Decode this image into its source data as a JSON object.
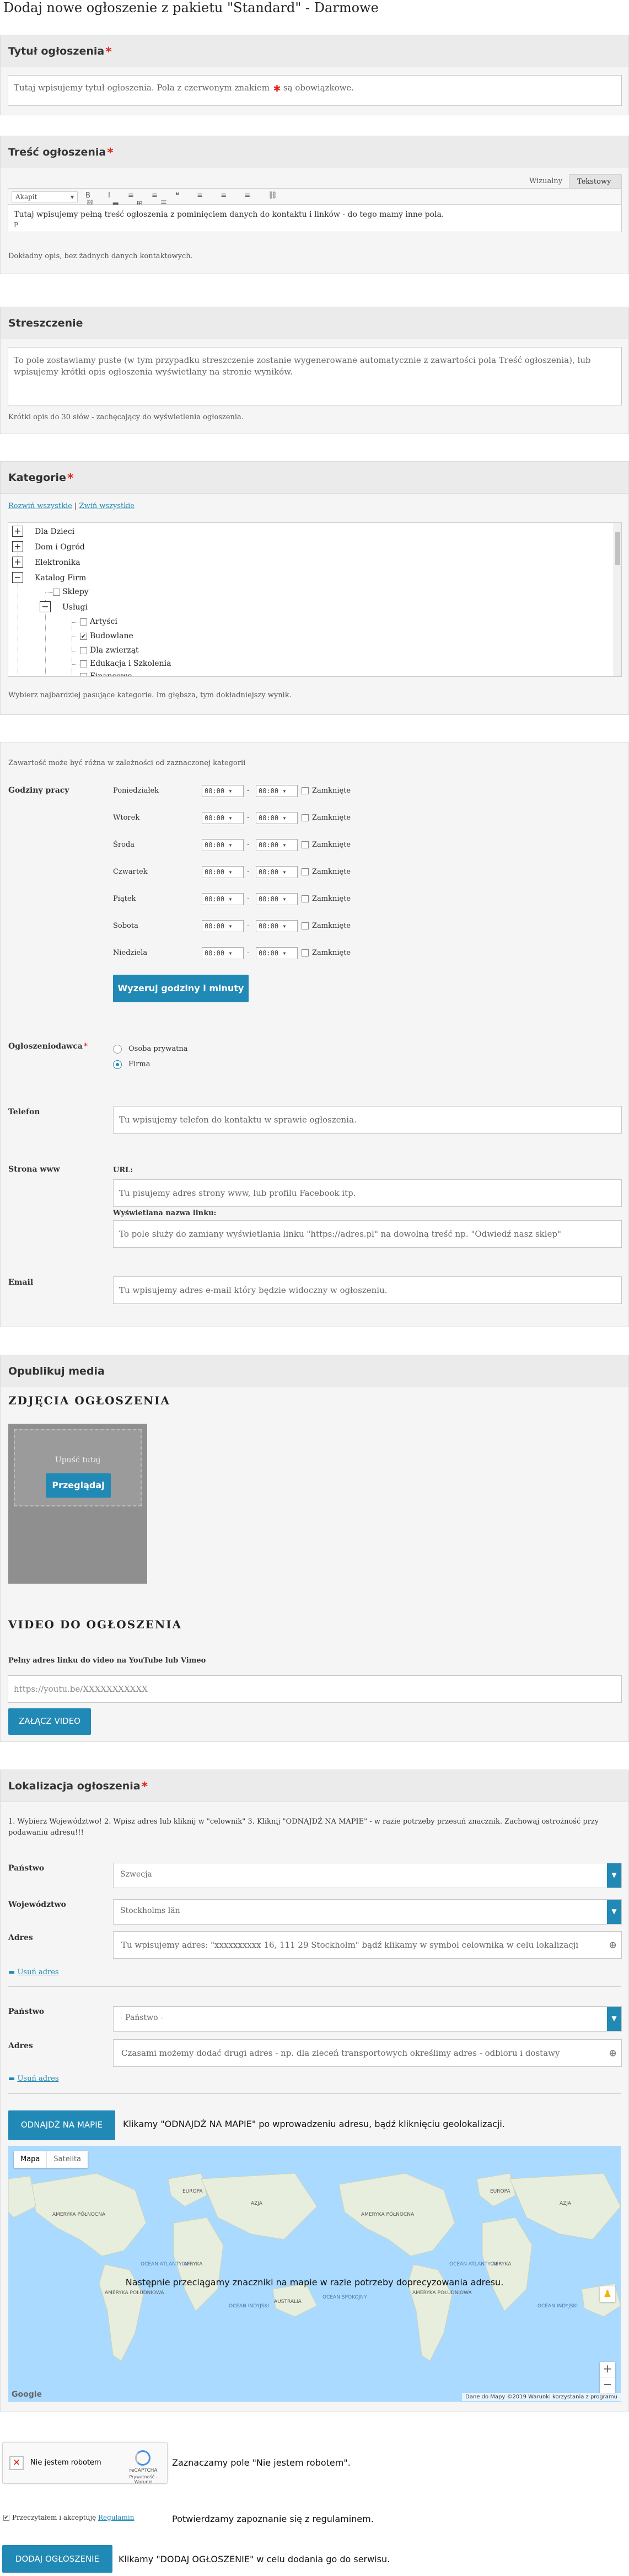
{
  "page": {
    "title": "Dodaj nowe ogłoszenie z pakietu \"Standard\" - Darmowe"
  },
  "title_section": {
    "heading": "Tytuł ogłoszenia",
    "required_mark": "*",
    "placeholder_pre": "Tutaj wpisujemy tytuł ogłoszenia. Pola z czerwonym znakiem",
    "placeholder_post": "są obowiązkowe."
  },
  "content_section": {
    "heading": "Treść ogłoszenia",
    "tab_visual": "Wizualny",
    "tab_text": "Tekstowy",
    "paragraph_select": "Akapit",
    "editor_text": "Tutaj wpisujemy pełną treść ogłoszenia z pominięciem danych do kontaktu i linków - do tego mamy inne pola.",
    "editor_status": "P",
    "hint": "Dokładny opis, bez żadnych danych kontaktowych."
  },
  "summary_section": {
    "heading": "Streszczenie",
    "placeholder": "To pole zostawiamy puste (w tym przypadku streszczenie zostanie wygenerowane automatycznie z zawartości pola Treść ogłoszenia), lub wpisujemy krótki opis ogłoszenia wyświetlany na stronie wyników.",
    "hint": "Krótki opis do 30 słów - zachęcający do wyświetlenia ogłoszenia."
  },
  "category_section": {
    "heading": "Kategorie",
    "expand_all": "Rozwiń wszystkie",
    "separator": "|",
    "collapse_all": "Zwiń wszystkie",
    "tree": [
      {
        "label": "Dla Dzieci",
        "box": "+"
      },
      {
        "label": "Dom i Ogród",
        "box": "+"
      },
      {
        "label": "Elektronika",
        "box": "+"
      },
      {
        "label": "Katalog Firm",
        "box": "−"
      },
      {
        "label": "Sklepy"
      },
      {
        "label": "Usługi",
        "box": "−"
      },
      {
        "label": "Artyści"
      },
      {
        "label": "Budowlane",
        "checked": true
      },
      {
        "label": "Dla zwierząt"
      },
      {
        "label": "Edukacja i Szkolenia"
      },
      {
        "label": "Finansowe"
      }
    ],
    "hint": "Wybierz najbardziej pasujące kategorie. Im głębsza, tym dokładniejszy wynik."
  },
  "details_section": {
    "note": "Zawartość może być różna w zależności od zaznaczonej kategorii",
    "hours_label": "Godziny pracy",
    "days": [
      "Poniedziałek",
      "Wtorek",
      "Środa",
      "Czwartek",
      "Piątek",
      "Sobota",
      "Niedziela"
    ],
    "time_placeholder": "00:00 ▾",
    "dash": "-",
    "closed_label": "Zamknięte",
    "reset_button": "Wyzeruj godziny i minuty",
    "advertiser_label": "Ogłoszeniodawca",
    "advertiser_options": [
      {
        "label": "Osoba prywatna",
        "selected": false
      },
      {
        "label": "Firma",
        "selected": true
      }
    ],
    "phone_label": "Telefon",
    "phone_placeholder": "Tu wpisujemy telefon do kontaktu w sprawie ogłoszenia.",
    "www_label": "Strona www",
    "url_label": "URL:",
    "url_placeholder": "Tu pisujemy adres strony www, lub profilu Facebook itp.",
    "display_label": "Wyświetlana nazwa linku:",
    "display_placeholder": "To pole służy do zamiany wyświetlania linku \"https://adres.pl\" na dowolną treść np. \"Odwiedź nasz sklep\"",
    "email_label": "Email",
    "email_placeholder": "Tu wpisujemy adres e-mail który będzie widoczny w ogłoszeniu."
  },
  "media_section": {
    "heading": "Opublikuj media",
    "photos_heading": "ZDJĘCIA OGŁOSZENIA",
    "drop_text": "Upuść tutaj",
    "browse_button": "Przeglądaj",
    "video_heading": "VIDEO DO OGŁOSZENIA",
    "video_label": "Pełny adres linku do video na YouTube lub Vimeo",
    "video_placeholder": "https://youtu.be/XXXXXXXXXXX",
    "attach_button": "ZAŁĄCZ VIDEO"
  },
  "location_section": {
    "heading": "Lokalizacja ogłoszenia",
    "instructions": "1. Wybierz Województwo! 2. Wpisz adres lub kliknij w \"celownik\" 3. Kliknij \"ODNAJDŹ NA MAPIE\" - w razie potrzeby przesuń znacznik. Zachowaj ostrożność przy podawaniu adresu!!!",
    "country_label": "Państwo",
    "country_value": "Szwecja",
    "region_label": "Województwo",
    "region_value": "Stockholms län",
    "address_label": "Adres",
    "address_placeholder": "Tu wpisujemy adres: \"xxxxxxxxxx 16, 111 29 Stockholm\" bądź klikamy w symbol celownika w celu lokalizacji",
    "remove_address": "Usuń adres",
    "country2_value": "- Państwo -",
    "address2_placeholder": "Czasami możemy dodać drugi adres - np. dla zleceń transportowych określimy adres - odbioru i dostawy",
    "find_button": "ODNAJDŹ NA MAPIE",
    "find_note": "Klikamy \"ODNAJDŹ NA MAPIE\" po wprowadzeniu adresu, bądź kliknięciu geolokalizacji.",
    "map_tab": "Mapa",
    "satellite_tab": "Satelita",
    "map_overlay": "Następnie przeciągamy znaczniki na mapie w razie potrzeby doprecyzowania adresu.",
    "zoom_in": "+",
    "zoom_out": "−",
    "google": "Google",
    "map_footer": "Dane do Mapy ©2019   Warunki korzystania z programu",
    "continents": [
      "AMERYKA PÓŁNOCNA",
      "AFRYKA",
      "OCEAN INDYJSKI",
      "AUSTRALIA",
      "AMERYKA POŁUDNIOWA",
      "OCEAN ATLANTYCKI",
      "OCEAN SPOKOJNY",
      "AZJA",
      "EUROPA"
    ]
  },
  "footer_section": {
    "recaptcha_label": "Nie jestem robotem",
    "recaptcha_brand": "reCAPTCHA",
    "recaptcha_sub": "Prywatność - Warunki",
    "recaptcha_note": "Zaznaczamy pole \"Nie jestem robotem\".",
    "terms_text": "Przeczytałem i akceptuję",
    "terms_link": "Regulamin",
    "terms_note": "Potwierdzamy zapoznanie się z regulaminem.",
    "submit_button": "DODAJ OGŁOSZENIE",
    "submit_note": "Klikamy \"DODAJ OGŁOSZENIE\" w celu dodania go do serwisu."
  },
  "colors": {
    "accent": "#2189b5",
    "required": "#e2231a",
    "panel": "#f5f5f5"
  }
}
